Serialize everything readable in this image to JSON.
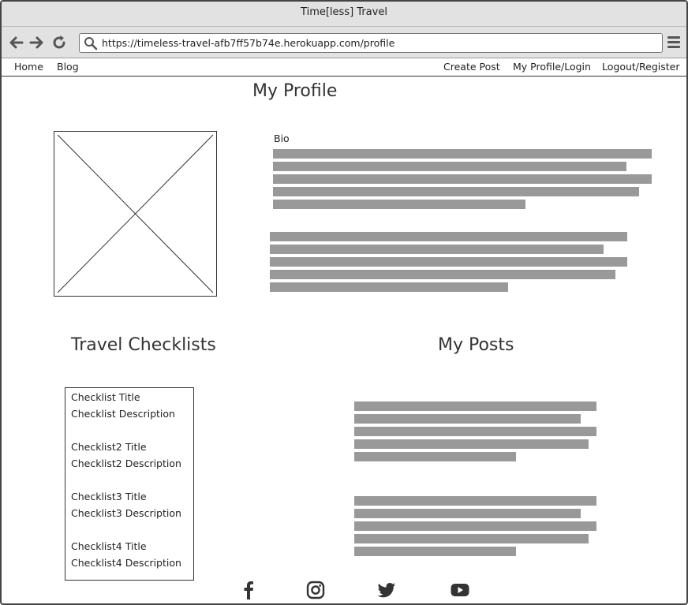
{
  "window": {
    "title": "Time[less] Travel"
  },
  "browser": {
    "url": "https://timeless-travel-afb7ff57b74e.herokuapp.com/profile",
    "back_icon": "arrow-left-icon",
    "forward_icon": "arrow-right-icon",
    "reload_icon": "reload-icon",
    "menu_icon": "hamburger-menu-icon"
  },
  "nav": {
    "home": "Home",
    "blog": "Blog",
    "create_post": "Create Post",
    "profile_login": "My Profile/Login",
    "logout_register": "Logout/Register"
  },
  "profile": {
    "title": "My Profile",
    "bio_label": "Bio"
  },
  "checklists": {
    "title": "Travel Checklists",
    "items": [
      {
        "title": "Checklist Title",
        "description": "Checklist Description"
      },
      {
        "title": "Checklist2 Title",
        "description": "Checklist2 Description"
      },
      {
        "title": "Checklist3 Title",
        "description": "Checklist3 Description"
      },
      {
        "title": "Checklist4 Title",
        "description": "Checklist4 Description"
      }
    ]
  },
  "posts": {
    "title": "My Posts"
  },
  "footer": {
    "icons": [
      "facebook-icon",
      "instagram-icon",
      "twitter-icon",
      "youtube-icon"
    ]
  },
  "colors": {
    "chrome": "#e2e2e2",
    "placeholder_text_bar": "#999999",
    "border": "#333333"
  }
}
